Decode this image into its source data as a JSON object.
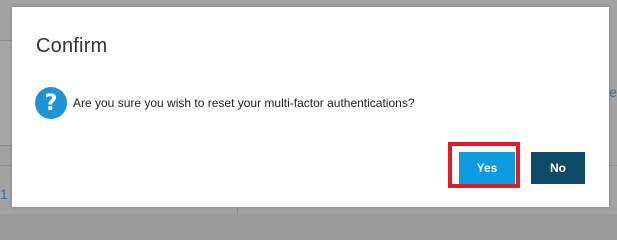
{
  "background": {
    "right_link_text": "e",
    "left_link_text": "1"
  },
  "dialog": {
    "title": "Confirm",
    "icon": "question-icon",
    "message": "Are you sure you wish to reset your multi-factor authentications?",
    "yes_label": "Yes",
    "no_label": "No",
    "colors": {
      "yes_button": "#0e9be0",
      "no_button": "#0d4a66",
      "highlight": "#e11b22",
      "icon": "#1e93d6"
    }
  }
}
